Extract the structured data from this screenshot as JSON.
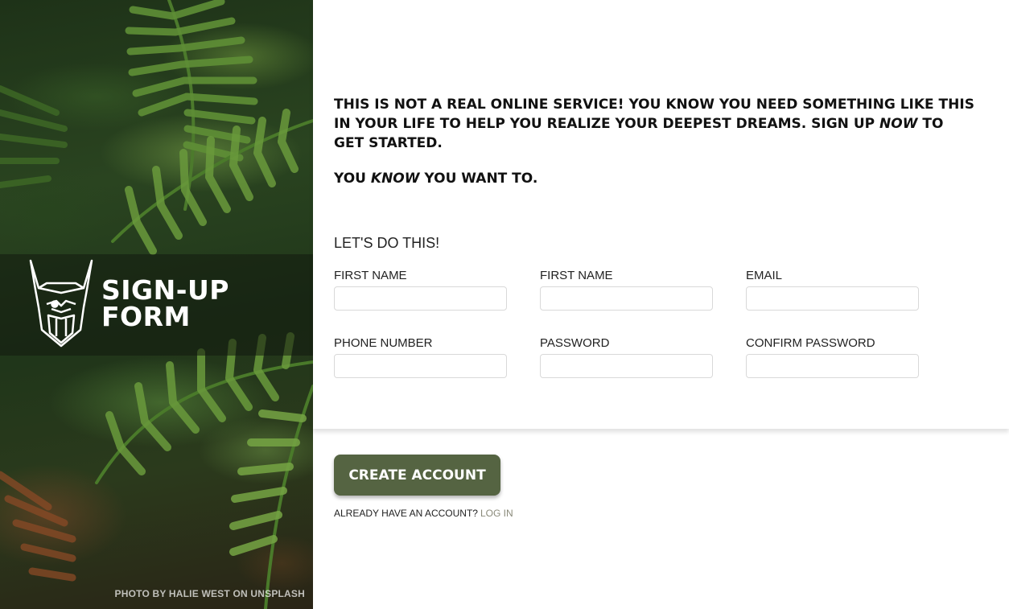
{
  "hero": {
    "brand_line1": "SIGN-UP",
    "brand_line2": "FORM",
    "photo_credit": "PHOTO BY HALIE WEST ON UNSPLASH",
    "logo_icon": "viking-helmet-logo-icon"
  },
  "intro": {
    "para1_part1": "THIS IS NOT A REAL ONLINE SERVICE! YOU KNOW YOU NEED SOMETHING LIKE THIS IN YOUR LIFE TO HELP YOU REALIZE YOUR DEEPEST DREAMS. SIGN UP ",
    "para1_em": "NOW",
    "para1_part2": " TO GET STARTED.",
    "para2_part1": "YOU ",
    "para2_em": "KNOW",
    "para2_part2": " YOU WANT TO."
  },
  "form": {
    "heading": "LET'S DO THIS!",
    "fields": [
      {
        "label": "FIRST NAME",
        "value": ""
      },
      {
        "label": "FIRST NAME",
        "value": ""
      },
      {
        "label": "EMAIL",
        "value": ""
      },
      {
        "label": "PHONE NUMBER",
        "value": ""
      },
      {
        "label": "PASSWORD",
        "value": ""
      },
      {
        "label": "CONFIRM PASSWORD",
        "value": ""
      }
    ],
    "submit_label": "CREATE ACCOUNT",
    "login_prompt": "ALREADY HAVE AN ACCOUNT?",
    "login_link": "LOG IN"
  },
  "colors": {
    "button_bg": "#556442",
    "button_text": "#ffffff",
    "link": "#8a8a7a"
  }
}
